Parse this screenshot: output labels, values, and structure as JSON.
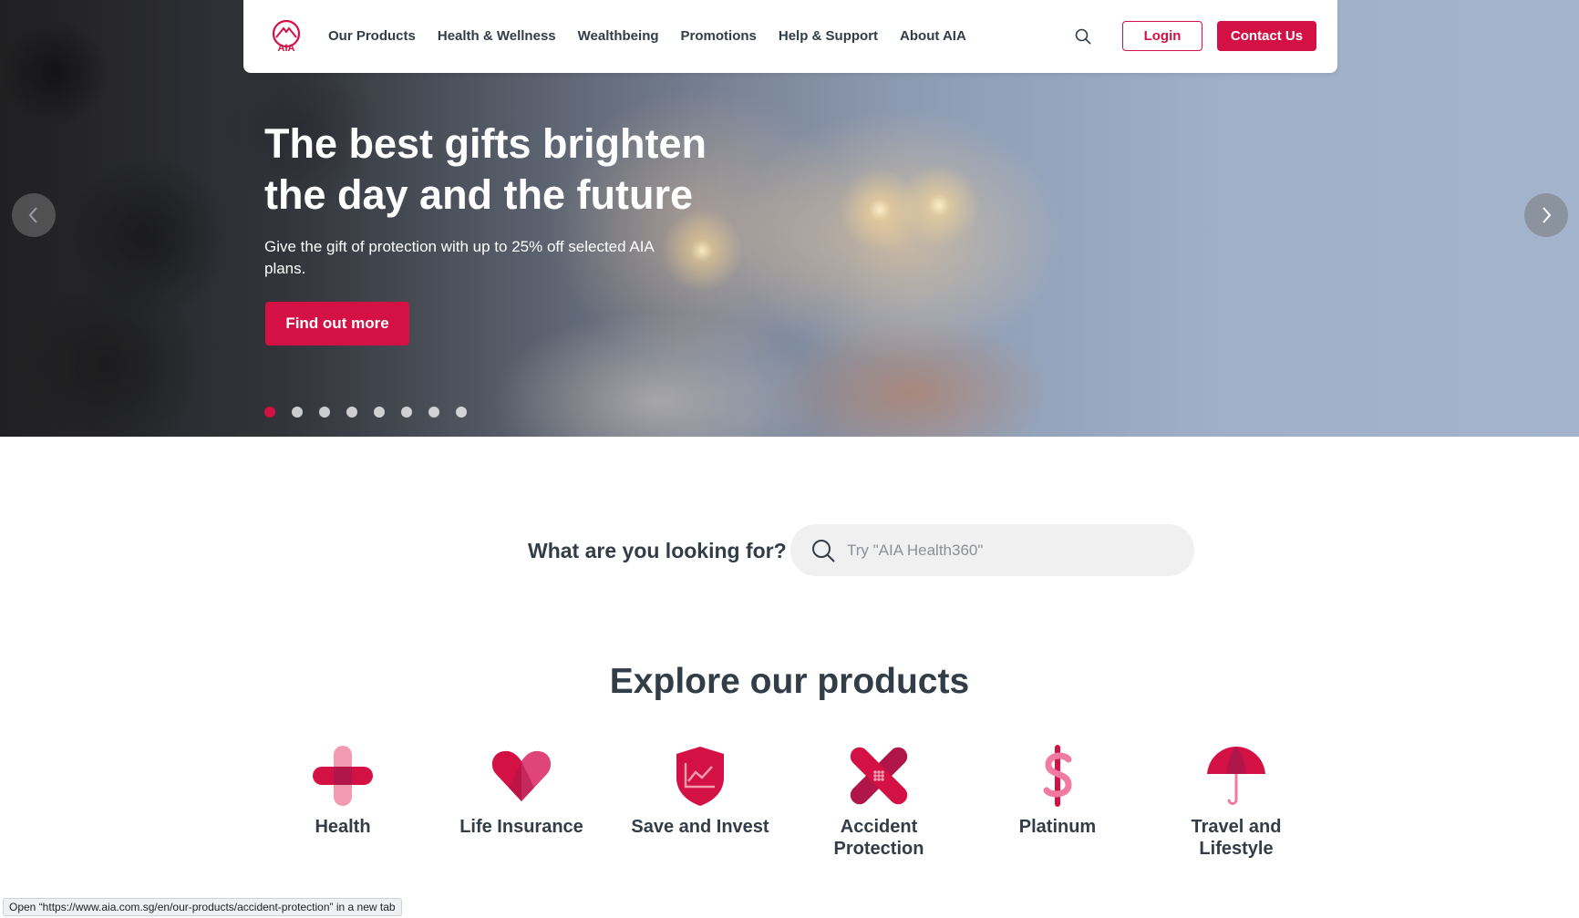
{
  "nav": {
    "links": [
      "Our Products",
      "Health & Wellness",
      "Wealthbeing",
      "Promotions",
      "Help & Support",
      "About AIA"
    ],
    "login_label": "Login",
    "contact_label": "Contact Us",
    "logo_text": "AIA"
  },
  "hero": {
    "title": "The best gifts brighten the day and the future",
    "subtitle": "Give the gift of protection with up to 25% off selected AIA plans.",
    "cta_label": "Find out more",
    "slides_total": 8,
    "active_slide": 1
  },
  "search": {
    "label": "What are you looking for?",
    "placeholder": "Try \"AIA Health360\""
  },
  "products": {
    "title": "Explore our products",
    "items": [
      {
        "label": "Health",
        "icon": "health-cross-icon"
      },
      {
        "label": "Life Insurance",
        "icon": "heart-icon"
      },
      {
        "label": "Save and Invest",
        "icon": "shield-chart-icon"
      },
      {
        "label": "Accident Protection",
        "icon": "bandage-icon"
      },
      {
        "label": "Platinum",
        "icon": "dollar-icon"
      },
      {
        "label": "Travel and Lifestyle",
        "icon": "umbrella-icon"
      }
    ]
  },
  "status_bar": {
    "text": "Open “https://www.aia.com.sg/en/our-products/accident-protection” in a new tab"
  },
  "colors": {
    "brand": "#d31145",
    "text": "#333d47"
  }
}
